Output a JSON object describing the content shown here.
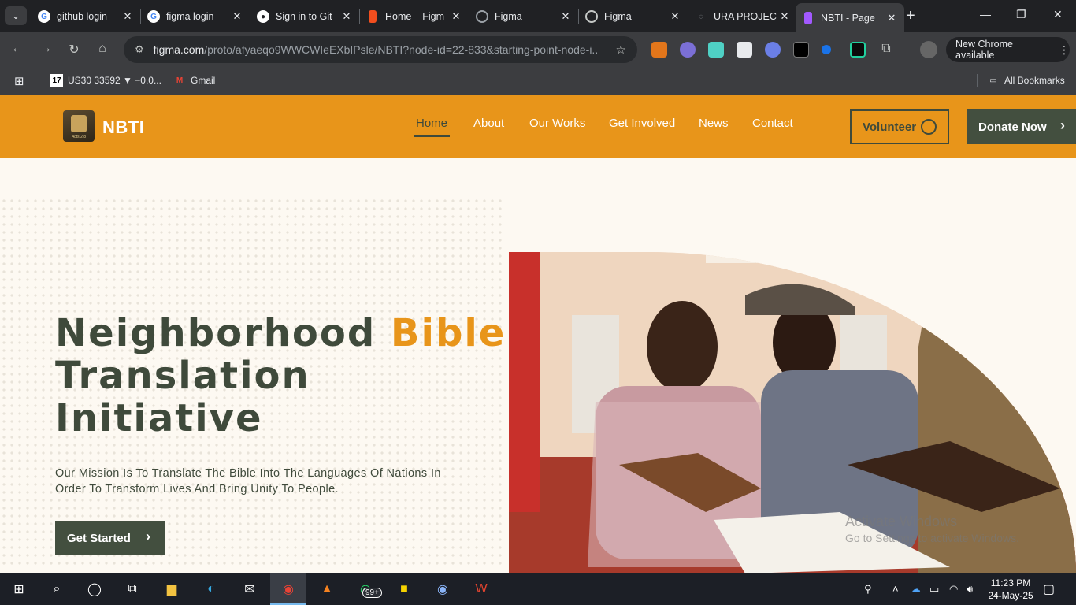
{
  "browser": {
    "tabs": [
      {
        "title": "github login",
        "favicon": "google-icon"
      },
      {
        "title": "figma login",
        "favicon": "google-icon"
      },
      {
        "title": "Sign in to Git",
        "favicon": "github-icon"
      },
      {
        "title": "Home – Figm",
        "favicon": "figma-icon"
      },
      {
        "title": "Figma",
        "favicon": "figma-spinner-icon"
      },
      {
        "title": "Figma",
        "favicon": "globe-icon"
      },
      {
        "title": "URA PROJEC",
        "favicon": "loading-icon"
      },
      {
        "title": "NBTI - Page",
        "favicon": "figma-icon",
        "active": true
      }
    ],
    "url_host": "figma.com",
    "url_path": "/proto/afyaeqo9WWCWIeEXbIPsle/NBTI?node-id=22-833&starting-point-node-i...",
    "update_label": "New Chrome available",
    "bookmarks": [
      {
        "label": "US30 33592 ▼ −0.0...",
        "icon": "tradingview-icon"
      },
      {
        "label": "Gmail",
        "icon": "gmail-icon"
      }
    ],
    "all_bookmarks_label": "All Bookmarks"
  },
  "site": {
    "logo_text": "NBTI",
    "logo_badge_text": "Acts 2:8",
    "nav": [
      {
        "label": "Home",
        "active": true
      },
      {
        "label": "About"
      },
      {
        "label": "Our Works"
      },
      {
        "label": "Get Involved"
      },
      {
        "label": "News"
      },
      {
        "label": "Contact"
      }
    ],
    "volunteer_label": "Volunteer",
    "donate_label": "Donate Now"
  },
  "hero": {
    "title_part1": "Neighborhood",
    "title_accent": "Bible",
    "title_line2": "Translation",
    "title_line3": "Initiative",
    "subtitle": "Our Mission Is To Translate The Bible Into The Languages Of Nations In Order To Transform Lives And Bring Unity To People.",
    "cta_label": "Get Started"
  },
  "watermark": {
    "line1": "Activate Windows",
    "line2": "Go to Settings to activate Windows."
  },
  "taskbar": {
    "whatsapp_badge": "99+",
    "time": "11:23 PM",
    "date": "24-May-25"
  },
  "colors": {
    "brand_orange": "#e8951a",
    "brand_green": "#434f3f",
    "page_bg": "#fdf9f2"
  }
}
